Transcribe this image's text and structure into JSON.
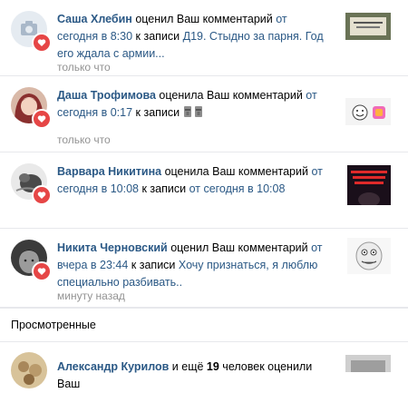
{
  "notifications": [
    {
      "name": "Саша Хлебин",
      "action": " оценил Ваш комментарий ",
      "date": "от сегодня в 8:30",
      "mid": " к записи ",
      "post": "Д19. Стыдно за парня. Год его ждала с армии...",
      "time": "только что",
      "thumb_text": "Доверие к отношениям"
    },
    {
      "name": "Даша Трофимова",
      "action": " оценила Ваш комментарий ",
      "date": "от сегодня в 0:17",
      "mid": " к записи ",
      "post_emoji": [
        "moai",
        "moai"
      ],
      "time": "только что",
      "thumb_text": ""
    },
    {
      "name": "Варвара Никитина",
      "action": " оценила Ваш комментарий ",
      "date": "от сегодня в 10:08",
      "mid": " к записи ",
      "post": "от сегодня в 10:08",
      "time": "",
      "thumb_text": "ВСТРЕЧА ГДЕ ТВОЯ ЖИЗНЬ?"
    },
    {
      "name": "Никита Черновский",
      "action": " оценил Ваш комментарий ",
      "date": "от вчера в 23:44",
      "mid": " к записи ",
      "post": "Хочу признаться, я люблю специально разбивать..",
      "time": "минуту назад",
      "thumb_text": ""
    }
  ],
  "section": {
    "title": "Просмотренные"
  },
  "last": {
    "name": "Александр Курилов",
    "mid": " и ещё ",
    "count": "19",
    "rest": " человек оценили Ваш"
  },
  "colors": {
    "link": "#2a5885",
    "heart": "#e64646",
    "muted": "#939393"
  }
}
